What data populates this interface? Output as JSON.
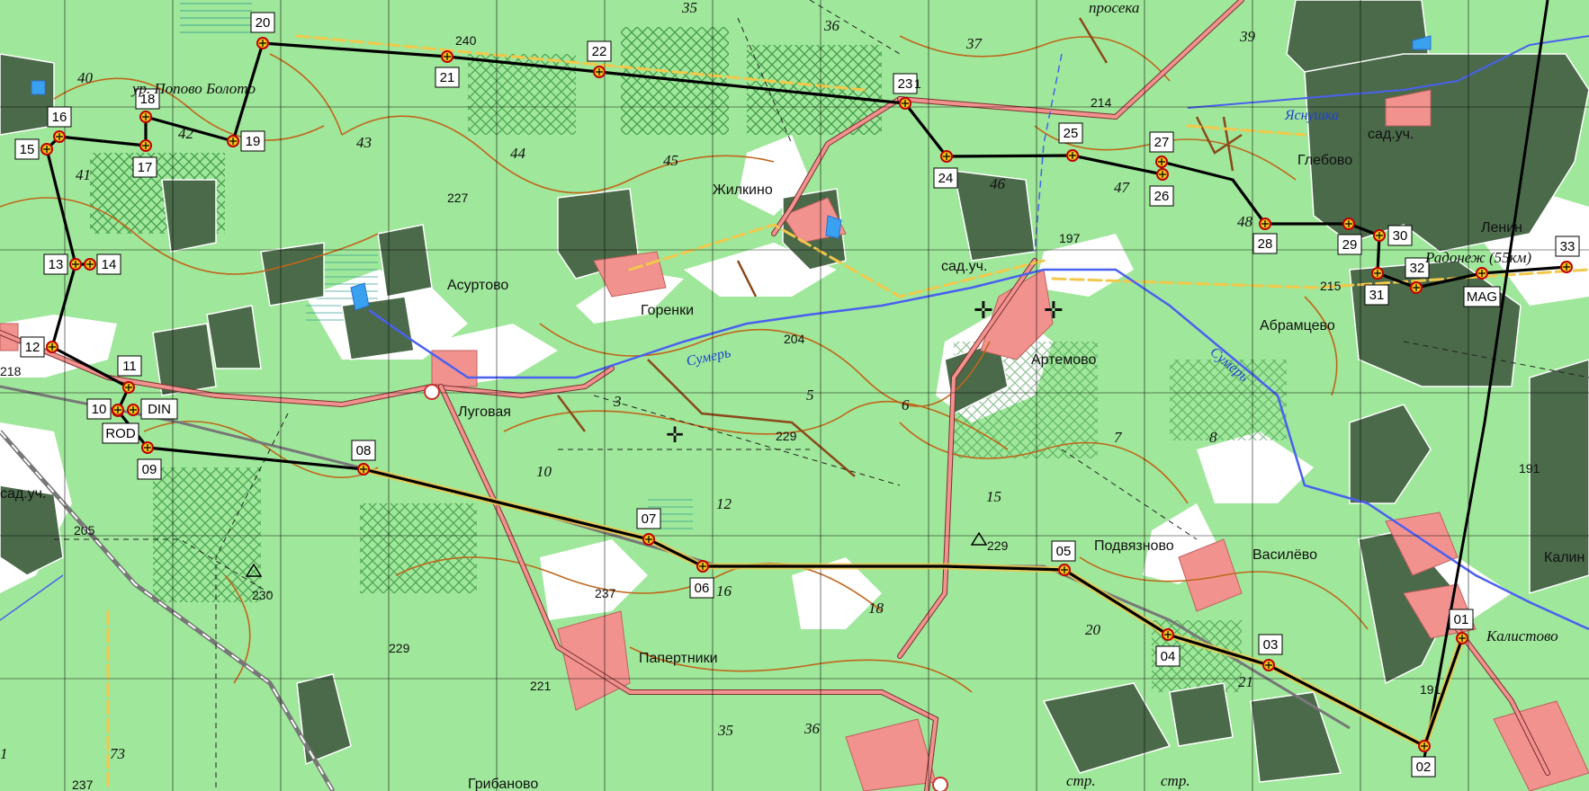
{
  "places": {
    "zhilkino": "Жилкино",
    "asurtovo": "Асуртово",
    "gorenki": "Горенки",
    "lugovaya": "Луговая",
    "artemovo": "Артемово",
    "podvyaznovo": "Подвязново",
    "papertniki": "Папертники",
    "gribanovo": "Грибаново",
    "glebovo": "Глебово",
    "abramtsevo": "Абрамцево",
    "vasilevo": "Василёво",
    "kalistovo": "Калистово",
    "kalin": "Калин",
    "lenin": "Ленин",
    "radonezh": "Радонеж (55км)",
    "popovo": "ур. Попово Болото",
    "sad1": "сад.уч.",
    "sad2": "сад.уч.",
    "sad3": "сад.уч.",
    "proseka": "просека",
    "str1": "стр.",
    "str2": "стр."
  },
  "rivers": {
    "sumer1": "Сумерь",
    "sumer2": "Сумерь",
    "yasnushka": "Яснушка"
  },
  "elevations": {
    "e240": "240",
    "e227": "227",
    "e218": "218",
    "e214": "214",
    "e197": "197",
    "e204": "204",
    "e229a": "229",
    "e229b": "229",
    "e229c": "229",
    "e230": "230",
    "e237a": "237",
    "e237b": "237",
    "e221": "221",
    "e205": "205",
    "e215": "215",
    "e191a": "191",
    "e191b": "191",
    "e231": "1"
  },
  "blocks": {
    "b35a": "35",
    "b36a": "36",
    "b37": "37",
    "b39": "39",
    "b40": "40",
    "b41": "41",
    "b42": "42",
    "b43": "43",
    "b44": "44",
    "b45": "45",
    "b46": "46",
    "b47": "47",
    "b48": "48",
    "b3": "3",
    "b5": "5",
    "b6": "6",
    "b7": "7",
    "b8": "8",
    "b10": "10",
    "b12": "12",
    "b15": "15",
    "b16": "16",
    "b18": "18",
    "b20": "20",
    "b21": "21",
    "b35b": "35",
    "b36b": "36",
    "b73": "73",
    "b1": "1"
  },
  "checkpoints": [
    {
      "label": "01"
    },
    {
      "label": "02"
    },
    {
      "label": "03"
    },
    {
      "label": "04"
    },
    {
      "label": "05"
    },
    {
      "label": "06"
    },
    {
      "label": "07"
    },
    {
      "label": "08"
    },
    {
      "label": "09"
    },
    {
      "label": "10"
    },
    {
      "label": "11"
    },
    {
      "label": "12"
    },
    {
      "label": "13"
    },
    {
      "label": "14"
    },
    {
      "label": "15"
    },
    {
      "label": "16"
    },
    {
      "label": "17"
    },
    {
      "label": "18"
    },
    {
      "label": "19"
    },
    {
      "label": "20"
    },
    {
      "label": "21"
    },
    {
      "label": "22"
    },
    {
      "label": "23"
    },
    {
      "label": "24"
    },
    {
      "label": "25"
    },
    {
      "label": "26"
    },
    {
      "label": "27"
    },
    {
      "label": "28"
    },
    {
      "label": "29"
    },
    {
      "label": "30"
    },
    {
      "label": "31"
    },
    {
      "label": "32"
    },
    {
      "label": "33"
    },
    {
      "label": "DIN"
    },
    {
      "label": "ROD"
    },
    {
      "label": "MAG"
    }
  ],
  "colors": {
    "forest": "#9fe79a",
    "open_field": "#ffffff",
    "settlement": "#f1928f",
    "dacha": "#4a6a4a",
    "road": "#e39a95",
    "contour": "#c0661b",
    "water": "#3a6bf0",
    "route": "#000000",
    "grid": "#000000"
  }
}
